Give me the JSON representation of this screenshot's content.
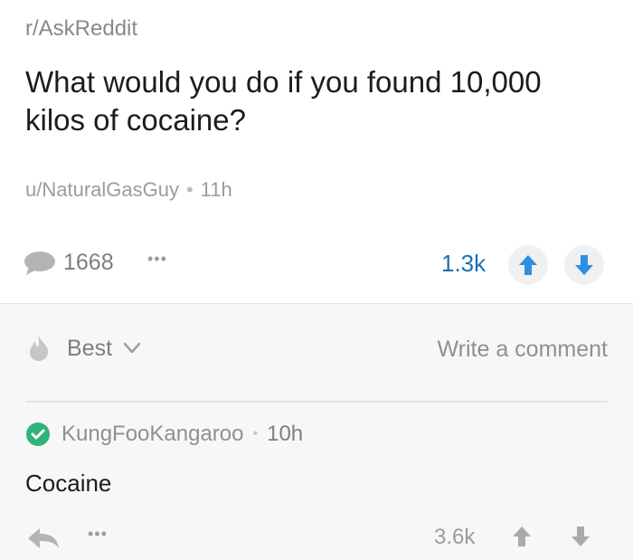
{
  "post": {
    "subreddit": "r/AskReddit",
    "title": "What would you do if you found 10,000 kilos of cocaine?",
    "author": "u/NaturalGasGuy",
    "age": "11h",
    "comment_count": "1668",
    "more": "•••",
    "score": "1.3k"
  },
  "comments_section": {
    "sort_label": "Best",
    "write_comment": "Write a comment"
  },
  "comment": {
    "author": "KungFooKangaroo",
    "age": "10h",
    "body": "Cocaine",
    "more": "•••",
    "score": "3.6k"
  },
  "colors": {
    "upvote": "#2d8fe0",
    "downvote": "#2d8fe0",
    "verified": "#2fb37a"
  },
  "icons": [
    "comment-bubble-icon",
    "upvote-arrow-icon",
    "downvote-arrow-icon",
    "fire-icon",
    "chevron-down-icon",
    "verified-check-icon",
    "reply-arrow-icon"
  ]
}
